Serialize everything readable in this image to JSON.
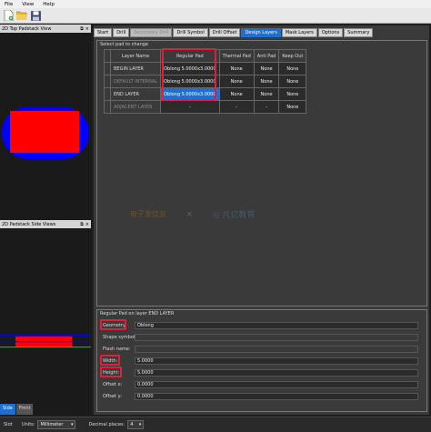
{
  "menu": [
    "File",
    "View",
    "Help"
  ],
  "panels": {
    "top_title": "2D Top Padstack View",
    "side_title": "2D Padstack Side Views",
    "side_tabs": [
      "Side",
      "Front"
    ]
  },
  "tabs": [
    "Start",
    "Drill",
    "Secondary Drill",
    "Drill Symbol",
    "Drill Offset",
    "Design Layers",
    "Mask Layers",
    "Options",
    "Summary"
  ],
  "active_tab": "Design Layers",
  "select_group_title": "Select pad to change",
  "table": {
    "headers": [
      "Layer Name",
      "Regular Pad",
      "Thermal Pad",
      "Anti Pad",
      "Keep Out"
    ],
    "rows": [
      {
        "layer": "BEGIN LAYER",
        "regular": "Oblong 5.0000x3.0000",
        "thermal": "None",
        "anti": "None",
        "keepout": "None"
      },
      {
        "layer": "DEFAULT INTERNAL",
        "regular": "Oblong 5.0000x3.0000",
        "thermal": "None",
        "anti": "None",
        "keepout": "None"
      },
      {
        "layer": "END LAYER",
        "regular": "Oblong 5.0000x3.0000",
        "thermal": "None",
        "anti": "None",
        "keepout": "None"
      },
      {
        "layer": "ADJACENT LAYER",
        "regular": "-",
        "thermal": "-",
        "anti": "-",
        "keepout": "None"
      }
    ]
  },
  "watermark": {
    "left": "电子发烧友",
    "cross": "✕",
    "right": "◎ 凡亿教育"
  },
  "props": {
    "group_title": "Regular Pad on layer END LAYER",
    "geometry_label": "Geometry:",
    "geometry_value": "Oblong",
    "shape_symbol_label": "Shape symbol:",
    "shape_symbol_value": "",
    "flash_name_label": "Flash name:",
    "flash_name_value": "",
    "width_label": "Width:",
    "width_value": "5.0000",
    "height_label": "Height:",
    "height_value": "5.0000",
    "offset_x_label": "Offset x:",
    "offset_x_value": "0.0000",
    "offset_y_label": "Offset y:",
    "offset_y_value": "0.0000"
  },
  "status": {
    "type_label": "Slot",
    "units_label": "Units:",
    "units_value": "Millimeter",
    "decimal_label": "Decimal places:",
    "decimal_value": "4"
  },
  "colors": {
    "accent_blue": "#1e6fd0",
    "highlight_red": "#e0203a",
    "pad_red": "#ff0000",
    "pad_blue": "#0000ff"
  }
}
